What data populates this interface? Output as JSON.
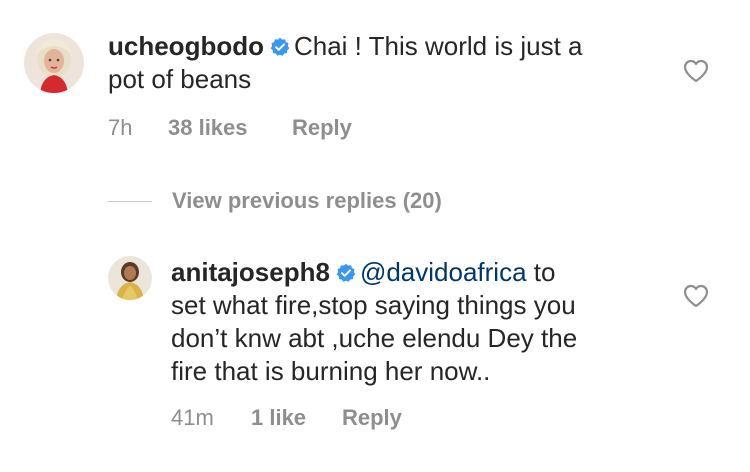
{
  "comments": [
    {
      "username": "ucheogbodo",
      "verified": true,
      "text": "Chai ! This world is just a pot of beans",
      "text_line1": "Chai ! This world is just a",
      "text_line2": "pot of beans",
      "time": "7h",
      "likes": "38 likes",
      "reply_label": "Reply",
      "like_icon": "heart-outline-icon"
    }
  ],
  "view_previous_replies": "View previous replies (20)",
  "replies": [
    {
      "username": "anitajoseph8",
      "verified": true,
      "mention": "@davidoafrica",
      "text_line1_rest": " to",
      "text_line2": "set what fire,stop saying things you",
      "text_line3": "don’t knw abt ,uche elendu Dey the",
      "text_line4": "fire that is burning her now..",
      "time": "41m",
      "likes": "1 like",
      "reply_label": "Reply",
      "like_icon": "heart-outline-icon"
    }
  ],
  "colors": {
    "text": "#262626",
    "secondary": "#8e8e8e",
    "mention": "#00376b",
    "verified": "#3897f0",
    "divider": "#c7c7c7"
  }
}
